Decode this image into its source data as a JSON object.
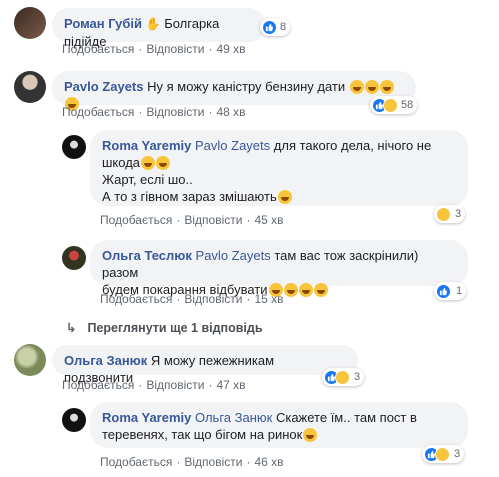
{
  "comments": [
    {
      "author": "Роман Губій",
      "text": "Болгарка підійде",
      "like": "Подобається",
      "reply": "Відповісти",
      "time": "49 хв",
      "reactions": "8"
    },
    {
      "author": "Pavlo Zayets",
      "text": "Ну я можу каністру бензину дати",
      "like": "Подобається",
      "reply": "Відповісти",
      "time": "48 хв",
      "reactions": "58"
    },
    {
      "author": "Roma Yaremiy",
      "mention": "Pavlo Zayets",
      "text1": "для такого дела, нічого не шкода",
      "text2": "Жарт, еслі шо..",
      "text3": "А то з гівном зараз змішають",
      "like": "Подобається",
      "reply": "Відповісти",
      "time": "45 хв",
      "reactions": "3"
    },
    {
      "author": "Ольга Теслюк",
      "mention": "Pavlo Zayets",
      "text1": "там вас тож заскрінили) разом",
      "text2": "будем покарання відбувати",
      "like": "Подобається",
      "reply": "Відповісти",
      "time": "15 хв",
      "reactions": "1"
    },
    {
      "author": "Ольга Занюк",
      "text": "Я можу пежежникам подзвонити",
      "like": "Подобається",
      "reply": "Відповісти",
      "time": "47 хв",
      "reactions": "3"
    },
    {
      "author": "Roma Yaremiy",
      "mention": "Ольга Занюк",
      "text1": "Скажете їм.. там пост в",
      "text2": "тереве­нях, так що бігом на ринок",
      "like": "Подобається",
      "reply": "Відповісти",
      "time": "46 хв",
      "reactions": "3"
    }
  ],
  "more_replies": "Переглянути ще 1 відповідь",
  "colors": {
    "accent": "#385898",
    "bubble": "#f2f3f5",
    "like": "#1877f2",
    "haha": "#f7c43b"
  },
  "icons": [
    "like-icon",
    "haha-icon",
    "reply-arrow-icon"
  ]
}
